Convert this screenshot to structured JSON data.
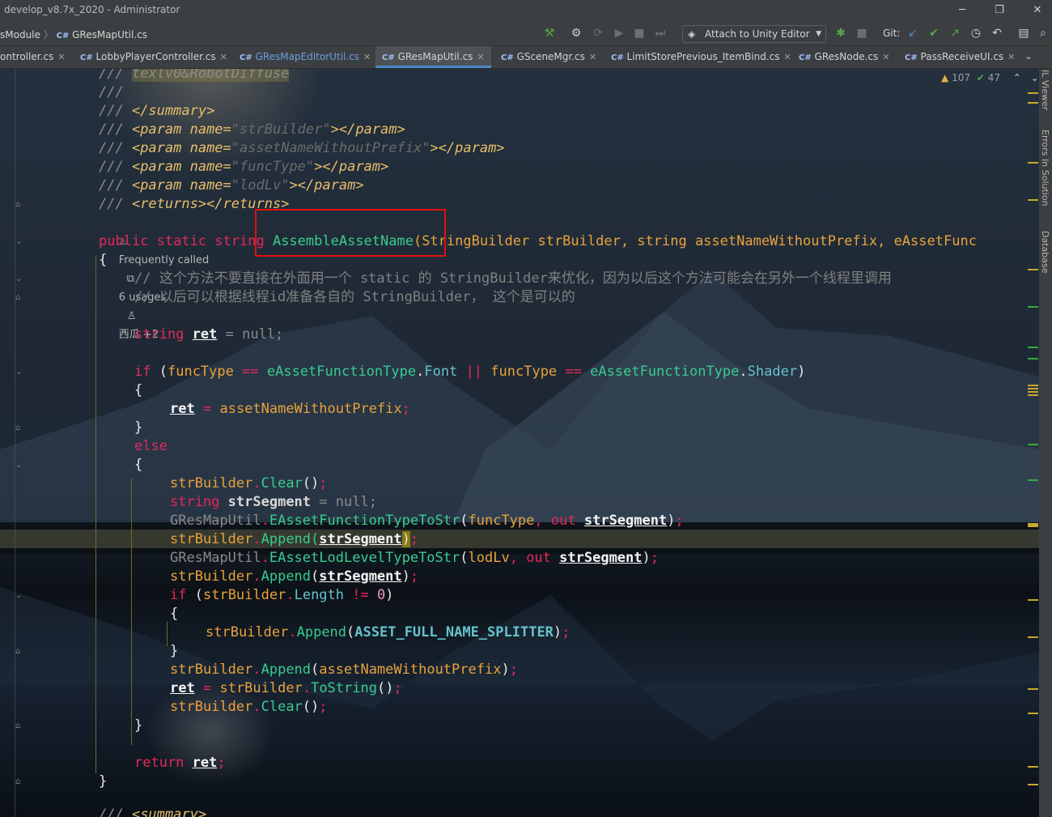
{
  "window": {
    "title": "develop_v8.7x_2020 - Administrator",
    "minimize": "─",
    "restore": "❐",
    "close": "✕"
  },
  "breadcrumb": {
    "module": "sModule",
    "separator": "〉",
    "file_lang": "C#",
    "file": "GResMapUtil.cs"
  },
  "toolbar": {
    "attach_label": "Attach to Unity Editor",
    "git_label": "Git:"
  },
  "tabs": [
    {
      "lang": "",
      "label": "ontroller.cs",
      "close": "✕"
    },
    {
      "lang": "C#",
      "label": "LobbyPlayerController.cs",
      "close": "✕"
    },
    {
      "lang": "C#",
      "label": "GResMapEditorUtil.cs",
      "close": "✕"
    },
    {
      "lang": "C#",
      "label": "GResMapUtil.cs",
      "close": "✕"
    },
    {
      "lang": "C#",
      "label": "GSceneMgr.cs",
      "close": "✕"
    },
    {
      "lang": "C#",
      "label": "LimitStorePrevious_ItemBind.cs",
      "close": "✕"
    },
    {
      "lang": "C#",
      "label": "GResNode.cs",
      "close": "✕"
    },
    {
      "lang": "C#",
      "label": "PassReceiveUI.cs",
      "close": "✕"
    }
  ],
  "inspections": {
    "warnings": "107",
    "ok": "47"
  },
  "side_panels": [
    "IL Viewer",
    "Errors In Solution",
    "Database"
  ],
  "code_vision": {
    "frequently_called": "Frequently called",
    "usages": "6 usages",
    "authors": "西瓜 +2"
  },
  "code": {
    "doc_texlv": "texlv0&RobotDiffuse",
    "doc_summary_close": "</summary>",
    "param_tag_open": "<param name=",
    "params": [
      "\"strBuilder\"",
      "\"assetNameWithoutPrefix\"",
      "\"funcType\"",
      "\"lodLv\""
    ],
    "param_tag_close": "></param>",
    "returns": "<returns></returns>",
    "signature": {
      "mods": "public static string",
      "name": "AssembleAssetName",
      "args": "(StringBuilder strBuilder, string assetNameWithoutPrefix, eAssetFunc"
    },
    "comment1": "// 这个方法不要直接在外面用一个 static 的 StringBuilder来优化，因为以后这个方法可能会在另外一个线程里调用",
    "comment2": "// 以后可以根据线程id准备各自的 StringBuilder， 这个是可以的"
  },
  "colors": {
    "accent": "#4a88c7",
    "highlight_box": "#e01010",
    "keyword": "#e4285a",
    "method": "#39cc8f",
    "type": "#e9a23b"
  }
}
